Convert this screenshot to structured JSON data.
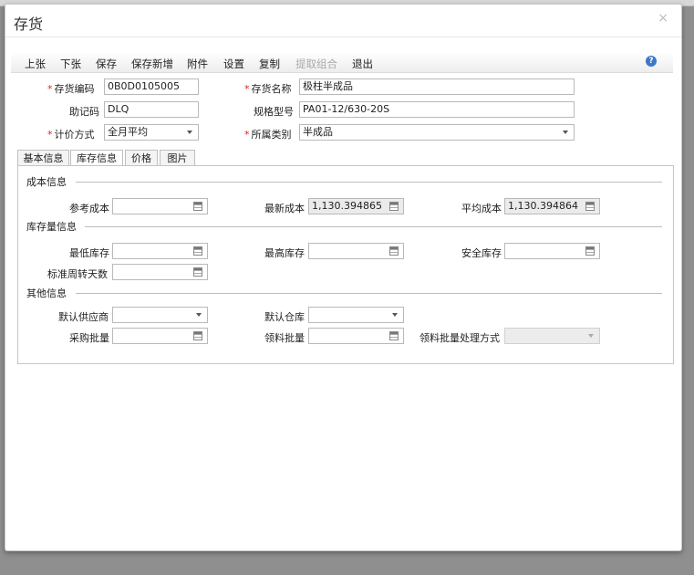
{
  "dialog": {
    "title": "存货",
    "close": "×"
  },
  "toolbar": {
    "items": [
      "上张",
      "下张",
      "保存",
      "保存新增",
      "附件",
      "设置",
      "复制",
      "提取组合",
      "退出"
    ],
    "help": "?"
  },
  "header_form": {
    "code_label": "存货编码",
    "code_value": "0B0D0105005",
    "name_label": "存货名称",
    "name_value": "极柱半成品",
    "mnemonic_label": "助记码",
    "mnemonic_value": "DLQ",
    "spec_label": "规格型号",
    "spec_value": "PA01-12/630-20S",
    "valuation_label": "计价方式",
    "valuation_value": "全月平均",
    "category_label": "所属类别",
    "category_value": "半成品"
  },
  "tabs": [
    "基本信息",
    "库存信息",
    "价格",
    "图片"
  ],
  "cost": {
    "section": "成本信息",
    "ref_label": "参考成本",
    "ref_value": "",
    "latest_label": "最新成本",
    "latest_value": "1,130.394865",
    "avg_label": "平均成本",
    "avg_value": "1,130.394864"
  },
  "stock": {
    "section": "库存量信息",
    "min_label": "最低库存",
    "min_value": "",
    "max_label": "最高库存",
    "max_value": "",
    "safe_label": "安全库存",
    "safe_value": "",
    "turnover_label": "标准周转天数",
    "turnover_value": ""
  },
  "other": {
    "section": "其他信息",
    "supplier_label": "默认供应商",
    "supplier_value": "",
    "warehouse_label": "默认仓库",
    "warehouse_value": "",
    "purchase_batch_label": "采购批量",
    "purchase_batch_value": "",
    "pick_batch_label": "领料批量",
    "pick_batch_value": "",
    "pick_method_label": "领料批量处理方式",
    "pick_method_value": ""
  },
  "colors": {
    "required": "#e02020",
    "help": "#3a78c9"
  }
}
